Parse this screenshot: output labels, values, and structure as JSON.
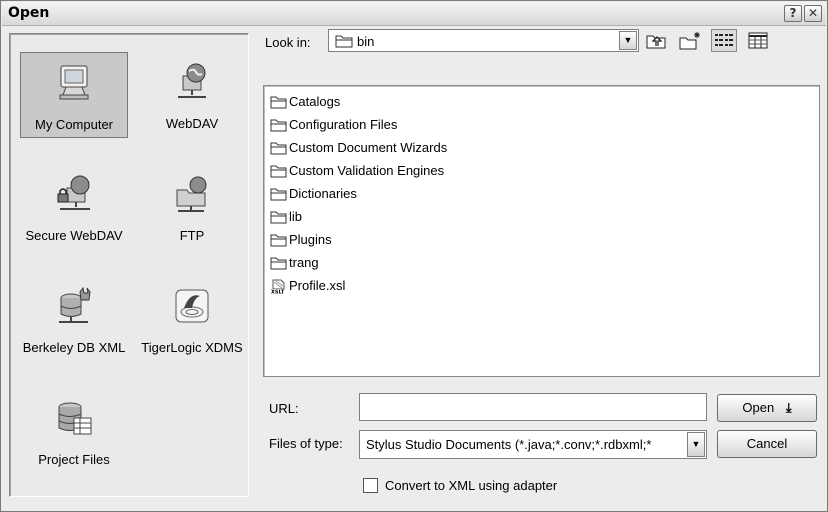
{
  "window": {
    "title": "Open",
    "help_button": "?",
    "close_button": "✕"
  },
  "places": [
    {
      "id": "my-computer",
      "label": "My Computer",
      "icon": "computer-icon",
      "selected": true
    },
    {
      "id": "webdav",
      "label": "WebDAV",
      "icon": "network-globe-icon",
      "selected": false
    },
    {
      "id": "secure-webdav",
      "label": "Secure WebDAV",
      "icon": "secure-network-globe-icon",
      "selected": false
    },
    {
      "id": "ftp",
      "label": "FTP",
      "icon": "ftp-folder-icon",
      "selected": false
    },
    {
      "id": "berkeley-db-xml",
      "label": "Berkeley DB XML",
      "icon": "database-cat-icon",
      "selected": false
    },
    {
      "id": "tigerlogic-xdms",
      "label": "TigerLogic XDMS",
      "icon": "tigerlogic-icon",
      "selected": false
    },
    {
      "id": "project-files",
      "label": "Project Files",
      "icon": "database-table-icon",
      "selected": false
    }
  ],
  "lookin": {
    "label": "Look in:",
    "value": "bin"
  },
  "toolbar": {
    "up_folder": "up-one-level-icon",
    "new_folder": "new-folder-icon",
    "list_view": "list-view-icon",
    "details_view": "details-view-icon"
  },
  "files": [
    {
      "name": "Catalogs",
      "type": "folder"
    },
    {
      "name": "Configuration Files",
      "type": "folder"
    },
    {
      "name": "Custom Document Wizards",
      "type": "folder"
    },
    {
      "name": "Custom Validation Engines",
      "type": "folder"
    },
    {
      "name": "Dictionaries",
      "type": "folder"
    },
    {
      "name": "lib",
      "type": "folder"
    },
    {
      "name": "Plugins",
      "type": "folder"
    },
    {
      "name": "trang",
      "type": "folder"
    },
    {
      "name": "Profile.xsl",
      "type": "xslt"
    }
  ],
  "url": {
    "label": "URL:",
    "value": ""
  },
  "filetype": {
    "label": "Files of type:",
    "value": "Stylus Studio Documents (*.java;*.conv;*.rdbxml;*"
  },
  "buttons": {
    "open": "Open",
    "cancel": "Cancel"
  },
  "convert": {
    "label": "Convert to XML using adapter",
    "checked": false
  },
  "colors": {
    "dialog_bg": "#ececec",
    "selection_bg": "#c9c9c9"
  }
}
